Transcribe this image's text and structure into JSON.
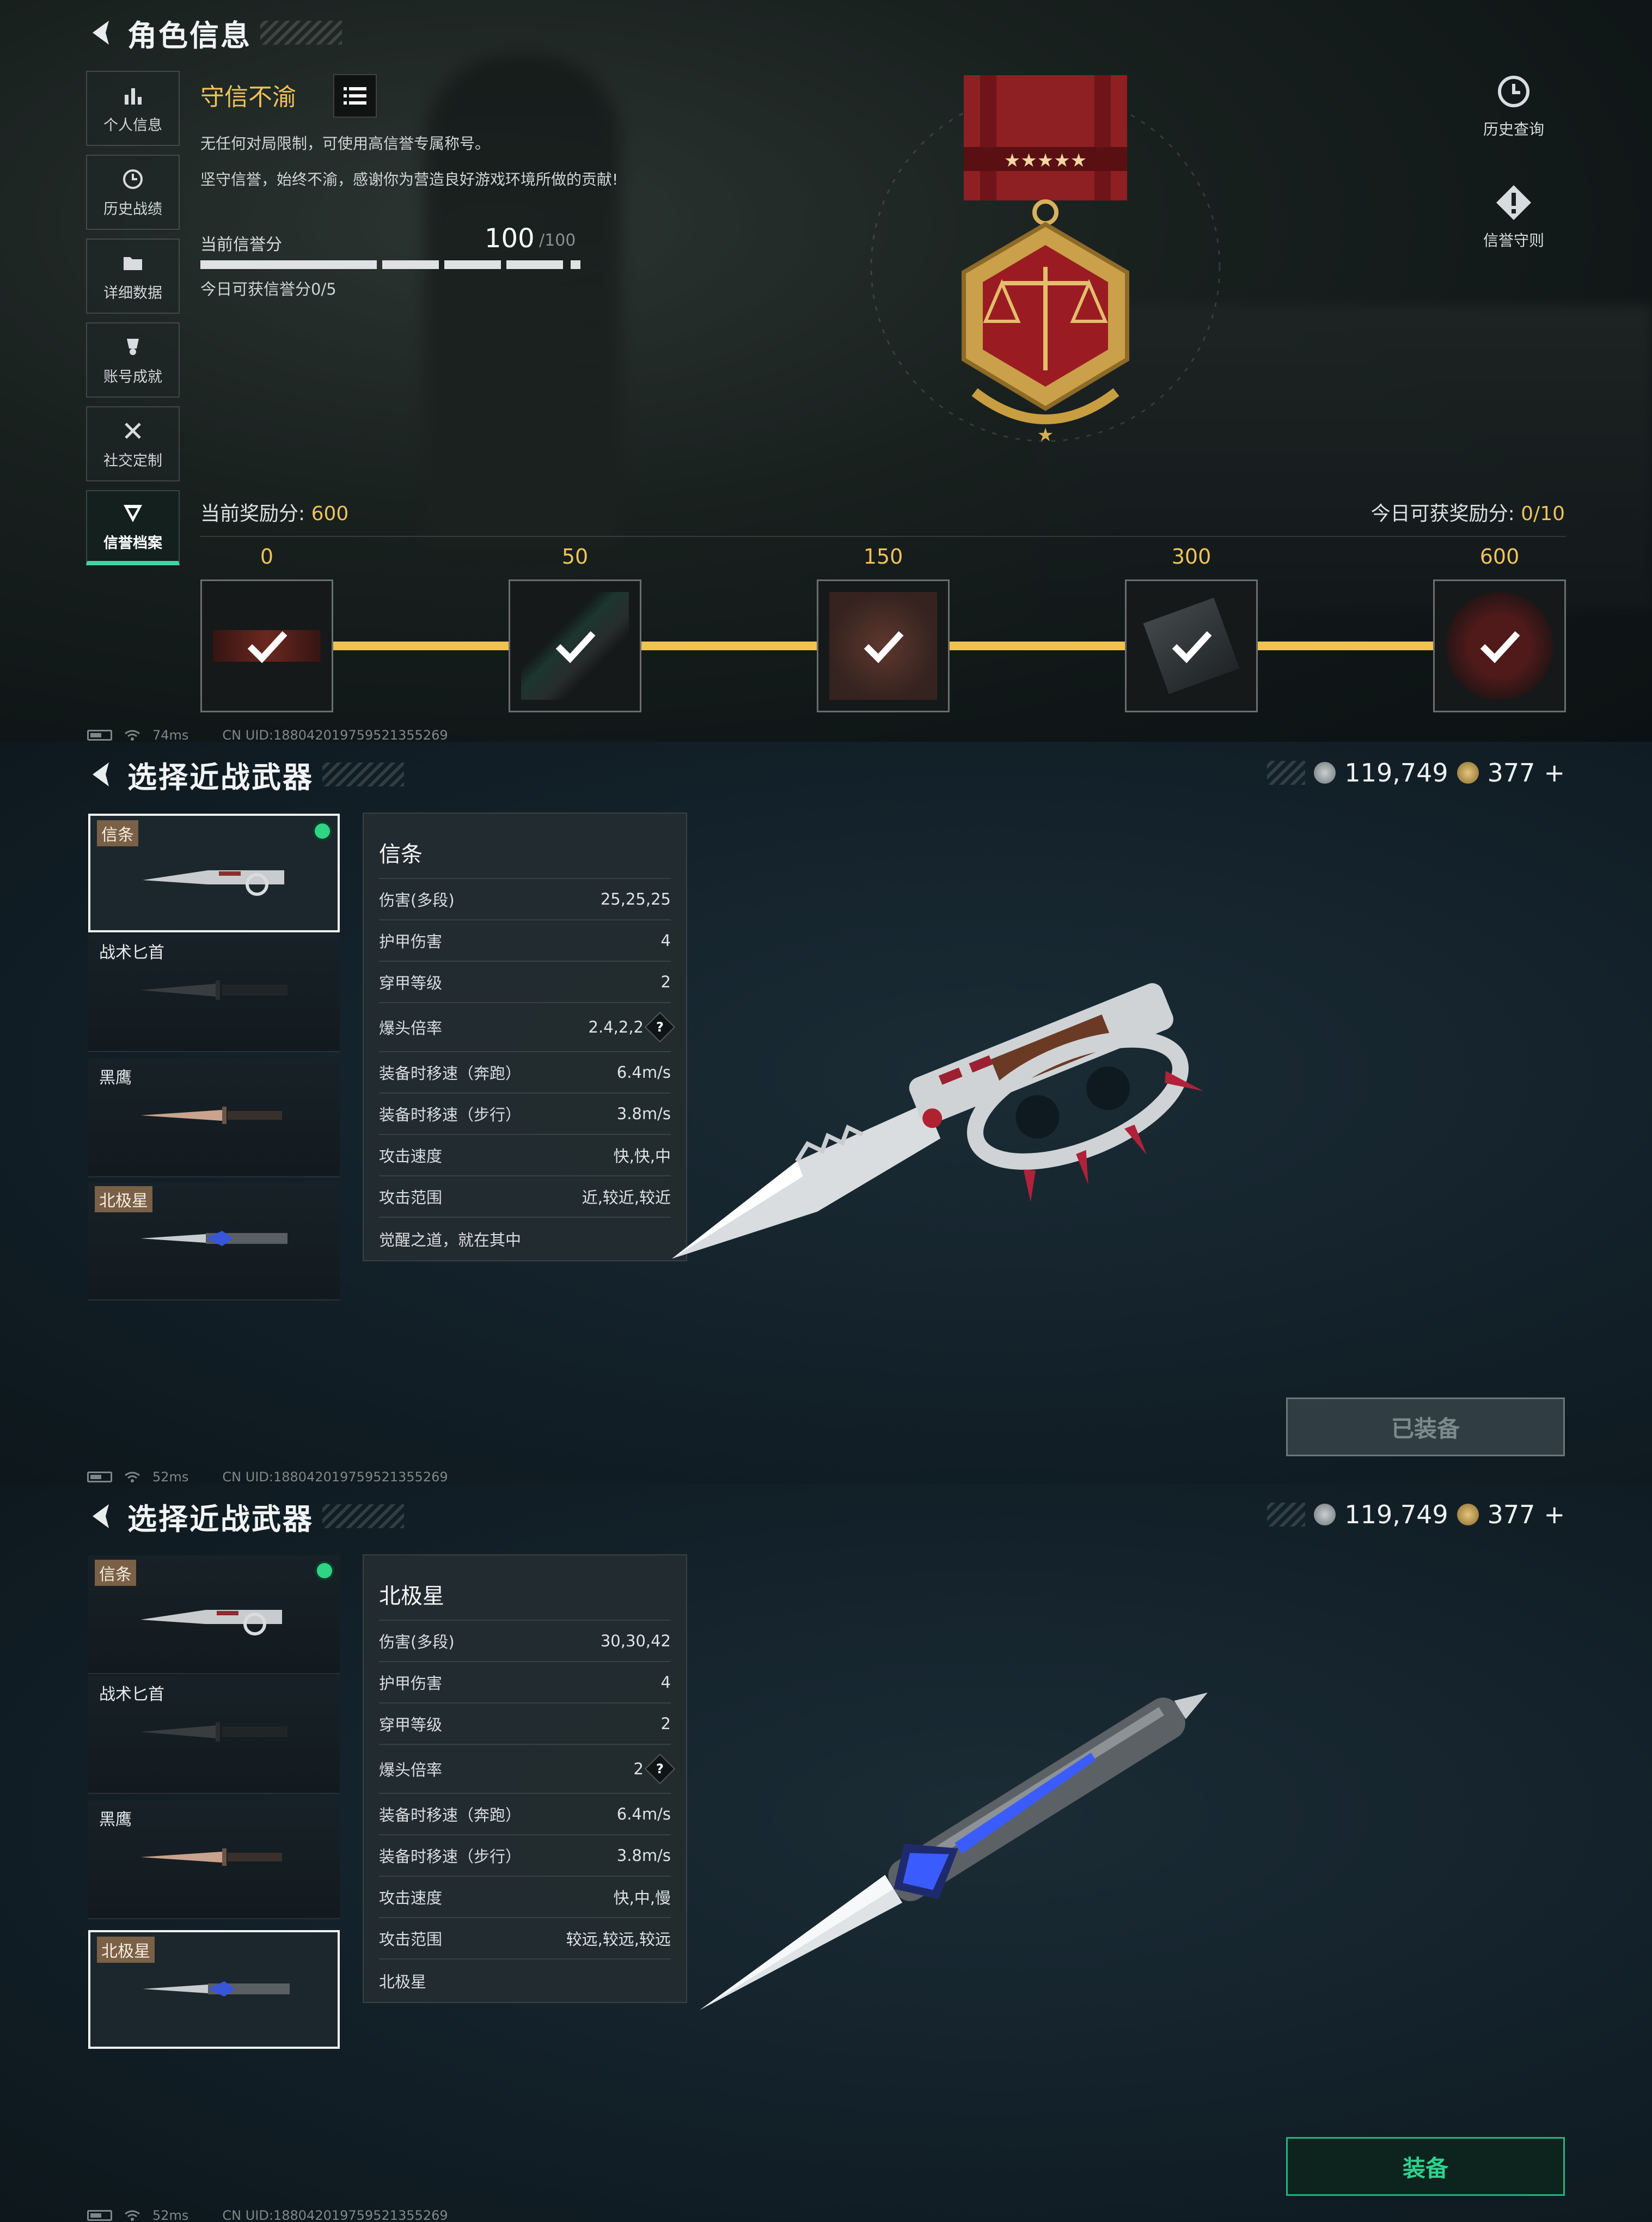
{
  "honor_panel": {
    "header_title": "角色信息",
    "nav": [
      "个人信息",
      "历史战绩",
      "详细数据",
      "账号成就",
      "社交定制",
      "信誉档案"
    ],
    "honor_title": "守信不渝",
    "desc1": "无任何对局限制，可使用高信誉专属称号。",
    "desc2": "坚守信誉，始终不渝，感谢你为营造良好游戏环境所做的贡献!",
    "score_label": "当前信誉分",
    "score": "100",
    "score_max": "/100",
    "score_fraction": 1.0,
    "today_label": "今日可获信誉分0/5",
    "history_label": "历史查询",
    "rules_label": "信誉守则",
    "reward_label": "当前奖励分:",
    "reward_value": "600",
    "today_reward_label": "今日可获奖励分:",
    "today_reward_value": "0/10",
    "milestones": [
      "0",
      "50",
      "150",
      "300",
      "600"
    ],
    "status_ping": "74ms",
    "uid": "CN UID:18804201975952135526​9"
  },
  "weapon_panel_1": {
    "header_title": "选择近战武器",
    "coins": "119,749",
    "tokens": "377",
    "plus": "+",
    "list": [
      "信条",
      "战术匕首",
      "黑鹰",
      "北极星"
    ],
    "stats_title": "信条",
    "stats": [
      {
        "k": "伤害(多段)",
        "v": "25,25,25"
      },
      {
        "k": "护甲伤害",
        "v": "4"
      },
      {
        "k": "穿甲等级",
        "v": "2"
      },
      {
        "k": "爆头倍率",
        "v": "2.4,2,2"
      },
      {
        "k": "装备时移速（奔跑）",
        "v": "6.4m/s"
      },
      {
        "k": "装备时移速（步行）",
        "v": "3.8m/s"
      },
      {
        "k": "攻击速度",
        "v": "快,快,中"
      },
      {
        "k": "攻击范围",
        "v": "近,较近,较近"
      }
    ],
    "foot": "觉醒之道，就在其中",
    "button": "已装备",
    "status_ping": "52ms",
    "uid": "CN UID:18804201975952135526​9"
  },
  "weapon_panel_2": {
    "header_title": "选择近战武器",
    "coins": "119,749",
    "tokens": "377",
    "plus": "+",
    "list": [
      "信条",
      "战术匕首",
      "黑鹰",
      "北极星"
    ],
    "stats_title": "北极星",
    "stats": [
      {
        "k": "伤害(多段)",
        "v": "30,30,42"
      },
      {
        "k": "护甲伤害",
        "v": "4"
      },
      {
        "k": "穿甲等级",
        "v": "2"
      },
      {
        "k": "爆头倍率",
        "v": "2"
      },
      {
        "k": "装备时移速（奔跑）",
        "v": "6.4m/s"
      },
      {
        "k": "装备时移速（步行）",
        "v": "3.8m/s"
      },
      {
        "k": "攻击速度",
        "v": "快,中,慢"
      },
      {
        "k": "攻击范围",
        "v": "较远,较远,较远"
      }
    ],
    "foot": "北极星",
    "button": "装备",
    "status_ping": "52ms",
    "uid": "CN UID:18804201975952135526​9"
  },
  "question_mark": "?",
  "colors": {
    "gold": "#f0c25a",
    "green": "#2fd18f",
    "track": "#f0c34c"
  }
}
